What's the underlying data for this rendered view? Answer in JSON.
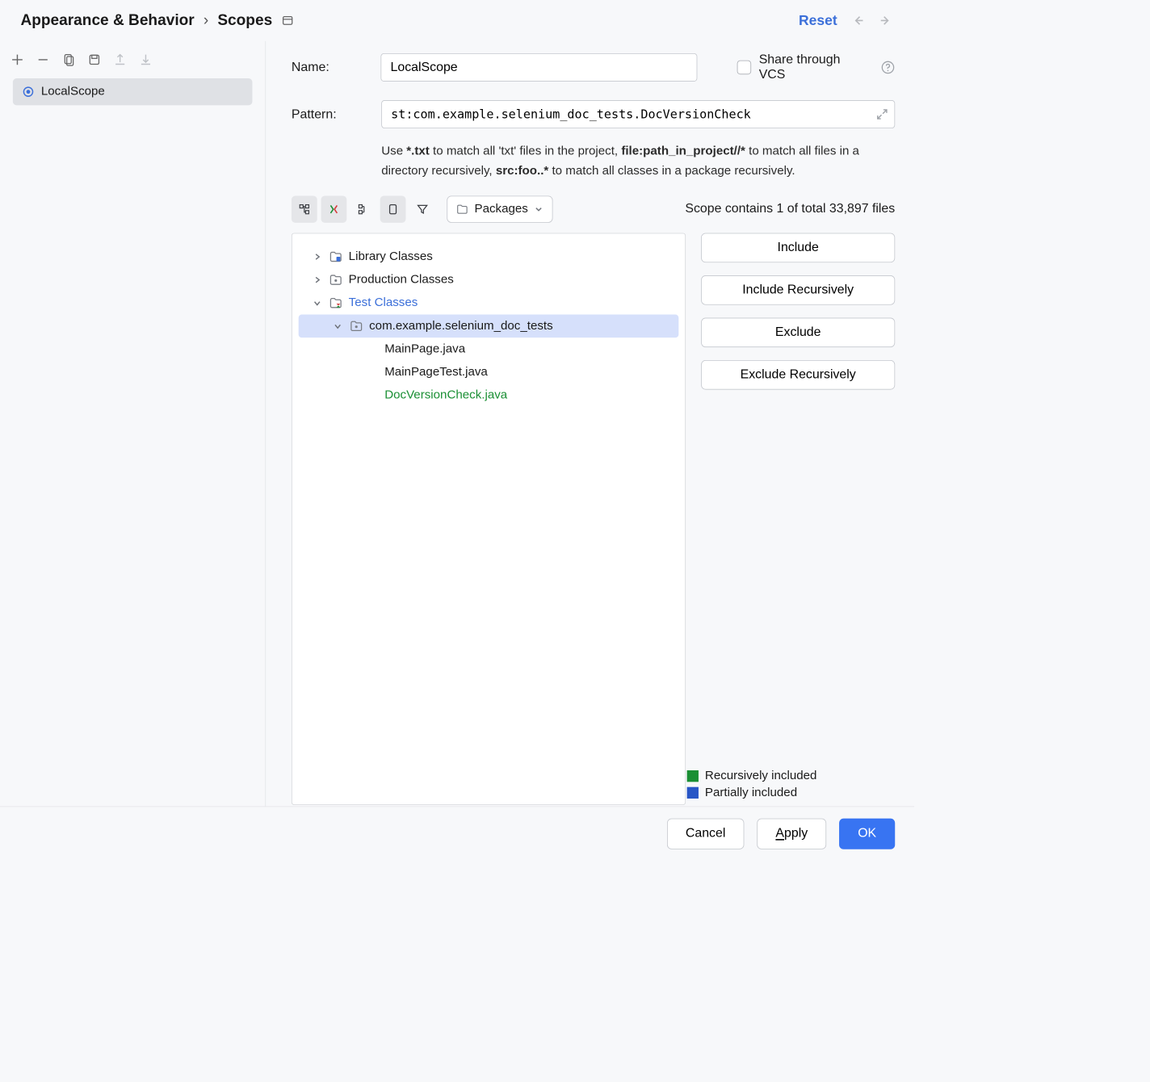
{
  "header": {
    "breadcrumb_root": "Appearance & Behavior",
    "breadcrumb_leaf": "Scopes",
    "reset": "Reset"
  },
  "sidebar": {
    "items": [
      {
        "label": "LocalScope"
      }
    ]
  },
  "form": {
    "name_label": "Name:",
    "name_value": "LocalScope",
    "share_label": "Share through VCS",
    "pattern_label": "Pattern:",
    "pattern_value": "st:com.example.selenium_doc_tests.DocVersionCheck",
    "hint_parts": {
      "p1": "Use ",
      "bold1": "*.txt",
      "p2": " to match all 'txt' files in the project, ",
      "bold2": "file:path_in_project//*",
      "p3": " to match all files in a directory recursively, ",
      "bold3": "src:foo..*",
      "p4": " to match all classes in a package recursively."
    }
  },
  "toolbar": {
    "dropdown_label": "Packages",
    "status": "Scope contains 1 of total 33,897 files"
  },
  "tree": {
    "rows": [
      {
        "label": "Library Classes",
        "indent": 1,
        "exp": "right",
        "folder": "lib",
        "color": "normal"
      },
      {
        "label": "Production Classes",
        "indent": 1,
        "exp": "right",
        "folder": "pkg",
        "color": "normal"
      },
      {
        "label": "Test Classes",
        "indent": 1,
        "exp": "down",
        "folder": "test",
        "color": "blue"
      },
      {
        "label": "com.example.selenium_doc_tests",
        "indent": 2,
        "exp": "down",
        "folder": "pkg",
        "color": "normal",
        "selected": true
      },
      {
        "label": "MainPage.java",
        "indent": 3,
        "exp": "",
        "folder": "",
        "color": "normal"
      },
      {
        "label": "MainPageTest.java",
        "indent": 3,
        "exp": "",
        "folder": "",
        "color": "normal"
      },
      {
        "label": "DocVersionCheck.java",
        "indent": 3,
        "exp": "",
        "folder": "",
        "color": "green"
      }
    ]
  },
  "actions": {
    "include": "Include",
    "include_r": "Include Recursively",
    "exclude": "Exclude",
    "exclude_r": "Exclude Recursively"
  },
  "legend": {
    "recursive": "Recursively included",
    "partial": "Partially included",
    "recursive_color": "#1a8f34",
    "partial_color": "#2856c6"
  },
  "footer": {
    "cancel": "Cancel",
    "apply": "Apply",
    "ok": "OK"
  }
}
